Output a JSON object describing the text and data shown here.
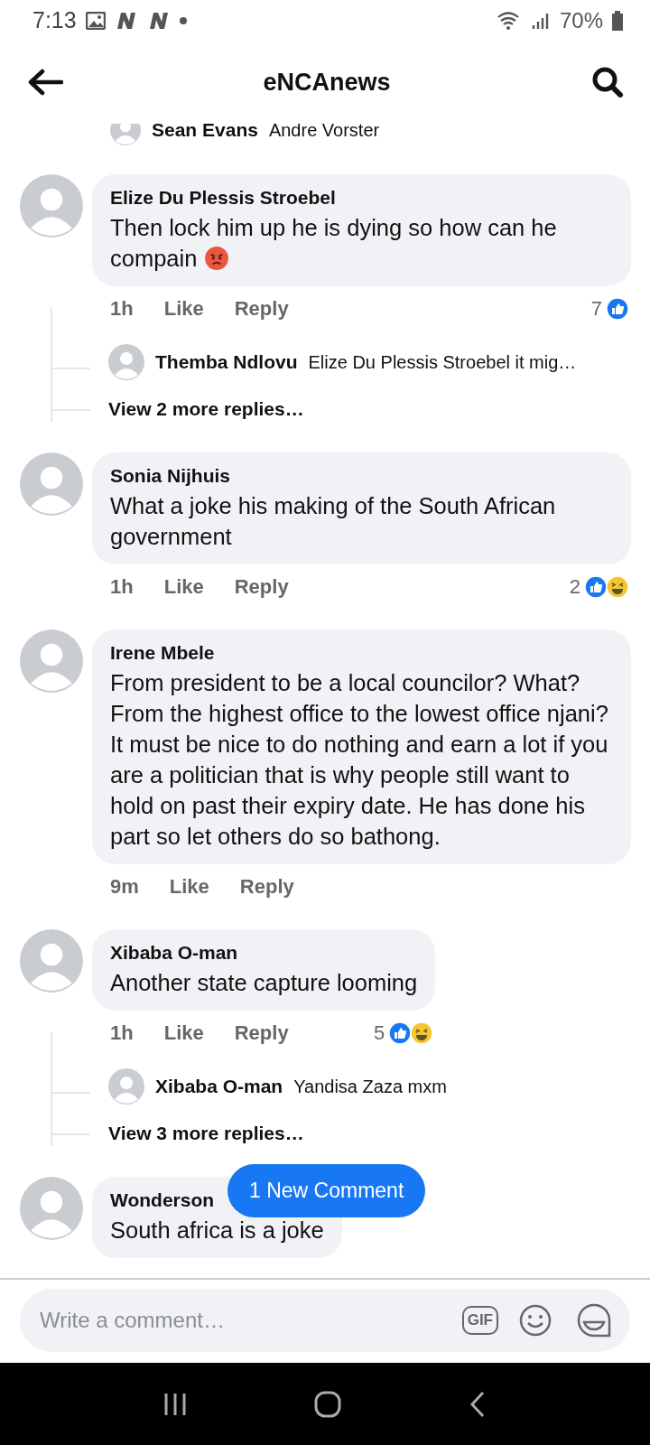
{
  "status_bar": {
    "time": "7:13",
    "battery": "70%"
  },
  "header": {
    "title": "eNCAnews"
  },
  "partial_reply": {
    "name": "Sean Evans",
    "text": "Andre Vorster"
  },
  "comments": [
    {
      "name": "Elize Du Plessis Stroebel",
      "text": "Then lock him up he is dying so how can he compain",
      "emoji": {
        "kind": "angry"
      },
      "time": "1h",
      "like": "Like",
      "reply": "Reply",
      "reaction_count": "7",
      "reactions": [
        {
          "kind": "like"
        }
      ],
      "replies": [
        {
          "name": "Themba Ndlovu",
          "text": "Elize Du Plessis Stroebel it mig…"
        }
      ],
      "more_replies": "View 2 more replies…"
    },
    {
      "name": "Sonia Nijhuis",
      "text": "What a joke his making of the South African government",
      "time": "1h",
      "like": "Like",
      "reply": "Reply",
      "reaction_count": "2",
      "reactions": [
        {
          "kind": "like"
        },
        {
          "kind": "haha"
        }
      ]
    },
    {
      "name": "Irene Mbele",
      "text": "From president to be a local councilor? What?  From the highest office to the lowest office njani?  It must be nice to do nothing and earn a lot if you are a politician that is why people still want to hold on past their expiry date. He has done his part so let others do so bathong.",
      "time": "9m",
      "like": "Like",
      "reply": "Reply"
    },
    {
      "name": "Xibaba O-man",
      "text": "Another state capture looming",
      "time": "1h",
      "like": "Like",
      "reply": "Reply",
      "reaction_count": "5",
      "reactions": [
        {
          "kind": "like"
        },
        {
          "kind": "haha"
        }
      ],
      "replies": [
        {
          "name": "Xibaba O-man",
          "text": "Yandisa Zaza mxm"
        }
      ],
      "more_replies": "View 3 more replies…"
    },
    {
      "name": "Wonderson",
      "text": "South africa is a joke"
    }
  ],
  "new_comment_button": "1 New Comment",
  "composer": {
    "placeholder": "Write a comment…",
    "gif_label": "GIF"
  }
}
